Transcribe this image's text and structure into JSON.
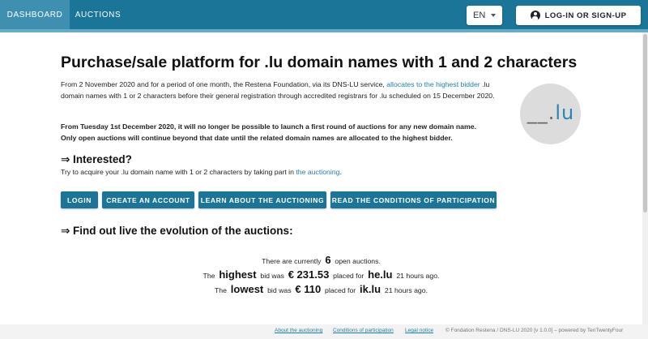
{
  "nav": {
    "dashboard": "DASHBOARD",
    "auctions": "AUCTIONS",
    "language": "EN",
    "login_signup": "LOG-IN OR SIGN-UP"
  },
  "main": {
    "title": "Purchase/sale platform for .lu domain names with 1 and 2 characters",
    "intro_before_link": "From 2 November 2020 and for a period of one month, the Restena Foundation, via its DNS-LU service, ",
    "intro_link": "allocates to the highest bidder",
    "intro_after_link": " .lu domain names with 1 or 2 characters before their general registration through accredited registrars for .lu scheduled on 15 December 2020.",
    "notice_line1": "From Tuesday 1st December 2020, it will no longer be possible to launch a first round of auctions for any new domain name.",
    "notice_line2": "Only open auctions will continue beyond that date until the related domain names are allocated to the highest bidder.",
    "logo_text_prefix": "__.",
    "logo_text_accent": "lu",
    "interested_heading": "⇒ Interested?",
    "interested_before_link": "Try to acquire your .lu domain name with 1 or 2 characters by taking part in ",
    "interested_link": "the auctioning",
    "interested_after_link": ".",
    "buttons": {
      "login": "LOGIN",
      "create_account": "CREATE AN ACCOUNT",
      "learn": "LEARN ABOUT THE AUCTIONING",
      "read_conditions": "READ THE CONDITIONS OF PARTICIPATION"
    },
    "live_heading": "⇒ Find out live the evolution of the auctions:",
    "stats": {
      "currently_prefix": "There are currently",
      "open_count": "6",
      "currently_suffix": "open auctions.",
      "the_1": "The",
      "highest": "highest",
      "bid_was_1": "bid was",
      "highest_amount": "€ 231.53",
      "placed_for_1": "placed for",
      "highest_domain": "he.lu",
      "highest_time": "21 hours ago.",
      "the_2": "The",
      "lowest": "lowest",
      "bid_was_2": "bid was",
      "lowest_amount": "€ 110",
      "placed_for_2": "placed for",
      "lowest_domain": "ik.lu",
      "lowest_time": "21 hours ago."
    }
  },
  "footer": {
    "about": "About the auctioning",
    "conditions": "Conditions of participation",
    "legal": "Legal notice",
    "copyright": "© Fondation Restena / DNS-LU 2020 [v 1.0.0] – powered by TenTwentyFour"
  },
  "colors": {
    "brand": "#1b7599",
    "link": "#1b7fb0"
  }
}
